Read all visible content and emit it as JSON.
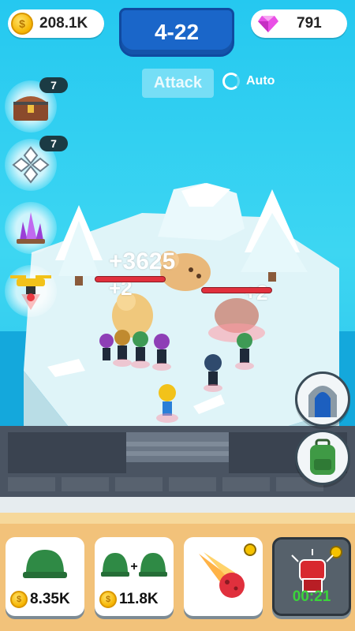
{
  "header": {
    "coins": "208.1K",
    "level": "4-22",
    "gems": "791"
  },
  "controls": {
    "attack_label": "Attack",
    "auto_label": "Auto"
  },
  "side_buttons": {
    "chest_badge": "7",
    "crystal_badge": "7"
  },
  "battle": {
    "damage_text": "+3625",
    "plus_left": "+2",
    "plus_right": "+2"
  },
  "shop": {
    "single_helmet_price": "8.35K",
    "double_helmet_price": "11.8K",
    "power_timer": "00:21"
  },
  "colors": {
    "sky": "#25c8f0",
    "level_blue": "#1a66c9",
    "gem_pink": "#e94fe6",
    "timer_green": "#3bd43b"
  }
}
